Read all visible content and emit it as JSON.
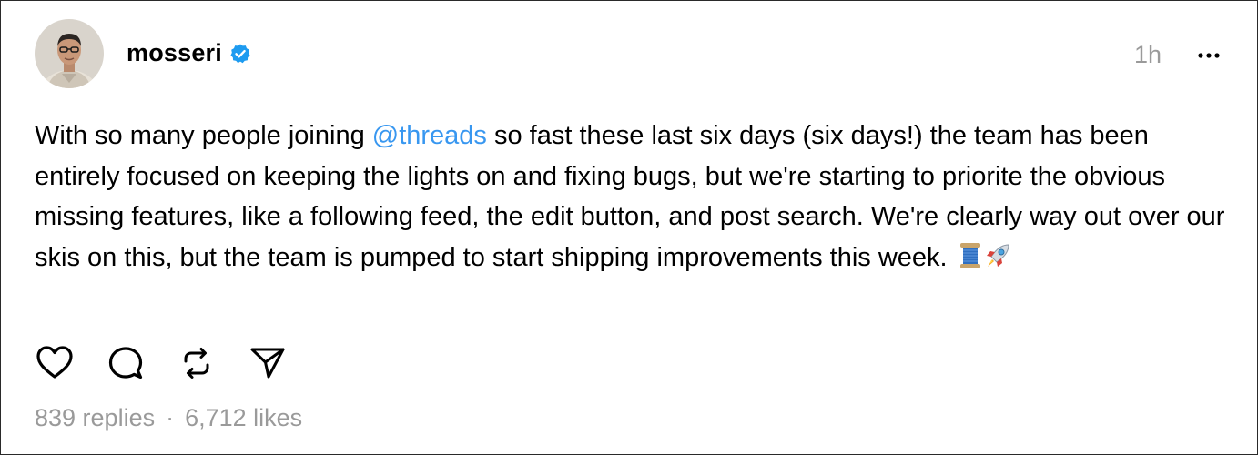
{
  "post": {
    "author": {
      "username": "mosseri",
      "verified": true,
      "verified_color": "#1d9bf0",
      "avatar_icon": "profile-photo"
    },
    "timestamp": "1h",
    "more_icon": "ellipsis-icon",
    "text": {
      "before_mention": "With so many people joining ",
      "mention": "@threads",
      "after_mention": " so fast these last six days (six days!) the team has been entirely focused on keeping the lights on and fixing bugs, but we're starting to priorite the obvious missing features, like a following feed, the edit button, and post search. We're clearly way out over our skis on this, but the team is pumped to start shipping improvements this week.",
      "emojis": [
        "spool-of-thread",
        "rocket"
      ],
      "mention_color": "#3897f0"
    },
    "actions": [
      {
        "name": "like",
        "icon": "heart-icon"
      },
      {
        "name": "reply",
        "icon": "comment-icon"
      },
      {
        "name": "repost",
        "icon": "repost-icon"
      },
      {
        "name": "share",
        "icon": "send-icon"
      }
    ],
    "stats": {
      "replies": "839 replies",
      "separator": "·",
      "likes": "6,712 likes"
    }
  }
}
